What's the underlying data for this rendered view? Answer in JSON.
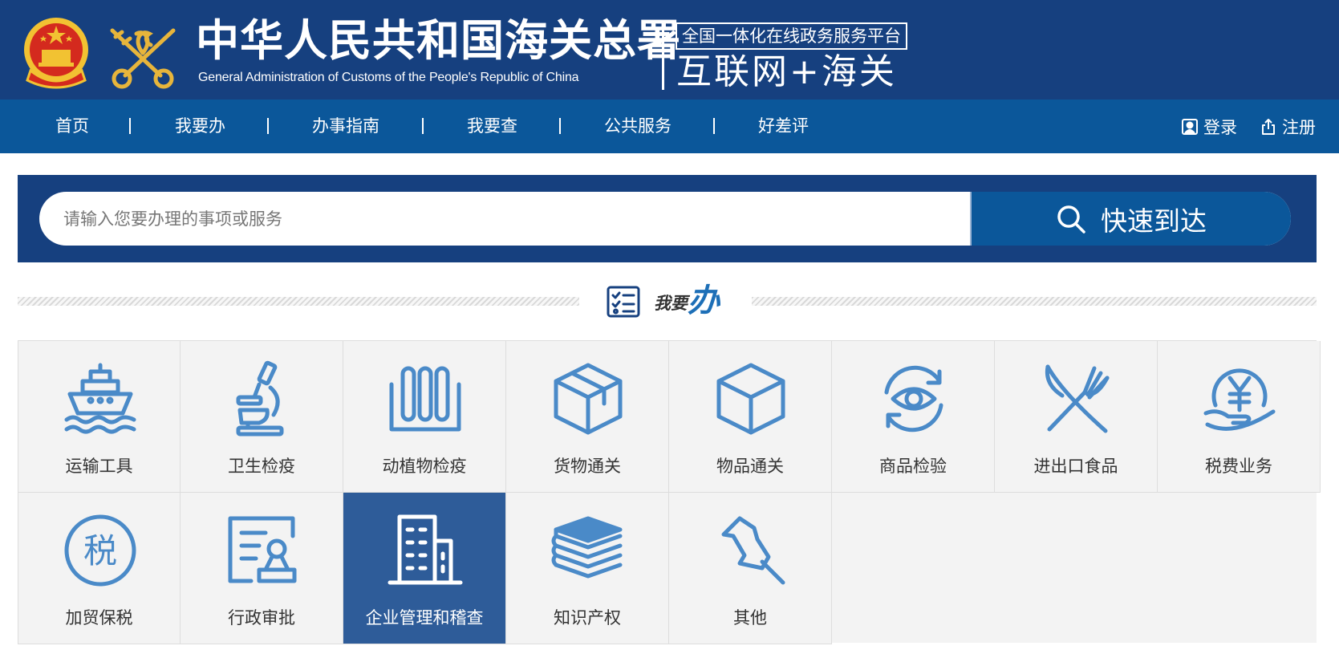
{
  "header": {
    "title_cn": "中华人民共和国海关总署",
    "title_en": "General Administration of Customs of the People's Republic of China",
    "platform": "全国一体化在线政务服务平台",
    "slogan": "互联网+海关",
    "emblem_icon": "national-emblem-icon",
    "logo_icon": "customs-keys-icon"
  },
  "nav": {
    "items": [
      {
        "label": "首页"
      },
      {
        "label": "我要办"
      },
      {
        "label": "办事指南"
      },
      {
        "label": "我要查"
      },
      {
        "label": "公共服务"
      },
      {
        "label": "好差评"
      }
    ],
    "login": "登录",
    "register": "注册"
  },
  "search": {
    "placeholder": "请输入您要办理的事项或服务",
    "button": "快速到达"
  },
  "section": {
    "small": "我要",
    "big": "办"
  },
  "services": [
    {
      "label": "运输工具",
      "icon": "ship-icon"
    },
    {
      "label": "卫生检疫",
      "icon": "microscope-icon"
    },
    {
      "label": "动植物检疫",
      "icon": "test-tubes-icon"
    },
    {
      "label": "货物通关",
      "icon": "open-box-icon"
    },
    {
      "label": "物品通关",
      "icon": "cube-icon"
    },
    {
      "label": "商品检验",
      "icon": "eye-refresh-icon"
    },
    {
      "label": "进出口食品",
      "icon": "fork-knife-icon"
    },
    {
      "label": "税费业务",
      "icon": "yuan-hand-icon"
    },
    {
      "label": "加贸保税",
      "icon": "tax-circle-icon"
    },
    {
      "label": "行政审批",
      "icon": "document-stamp-icon"
    },
    {
      "label": "企业管理和稽查",
      "icon": "building-icon",
      "active": true
    },
    {
      "label": "知识产权",
      "icon": "books-icon"
    },
    {
      "label": "其他",
      "icon": "pushpin-icon"
    }
  ],
  "tax_glyph": "税",
  "colors": {
    "header_bg": "#16407f",
    "nav_bg": "#0b579a",
    "icon_blue": "#4a8ac8",
    "active_tile": "#2e5c99"
  }
}
